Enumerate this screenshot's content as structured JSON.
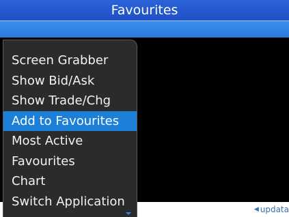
{
  "title_bar": {
    "title": "Favourites"
  },
  "menu": {
    "items": [
      {
        "label": "Screen Grabber",
        "selected": false
      },
      {
        "label": "Show Bid/Ask",
        "selected": false
      },
      {
        "label": "Show Trade/Chg",
        "selected": false
      },
      {
        "label": "Add to Favourites",
        "selected": true
      },
      {
        "label": "Most Active",
        "selected": false
      },
      {
        "label": "Favourites",
        "selected": false
      },
      {
        "label": "Chart",
        "selected": false
      },
      {
        "label": "Switch Application",
        "selected": false
      }
    ],
    "scroll_indicator_icon": "chevron-down-icon"
  },
  "footer": {
    "logo_text": "updata",
    "logo_icon": "arrow-left-icon"
  },
  "colors": {
    "title_bar": "#1f4fc4",
    "sub_bar": "#2a7ae0",
    "menu_background": "#2b2b2b",
    "menu_selected": "#1c7fd8",
    "content_background": "#000000",
    "footer_background": "#ffffff"
  }
}
